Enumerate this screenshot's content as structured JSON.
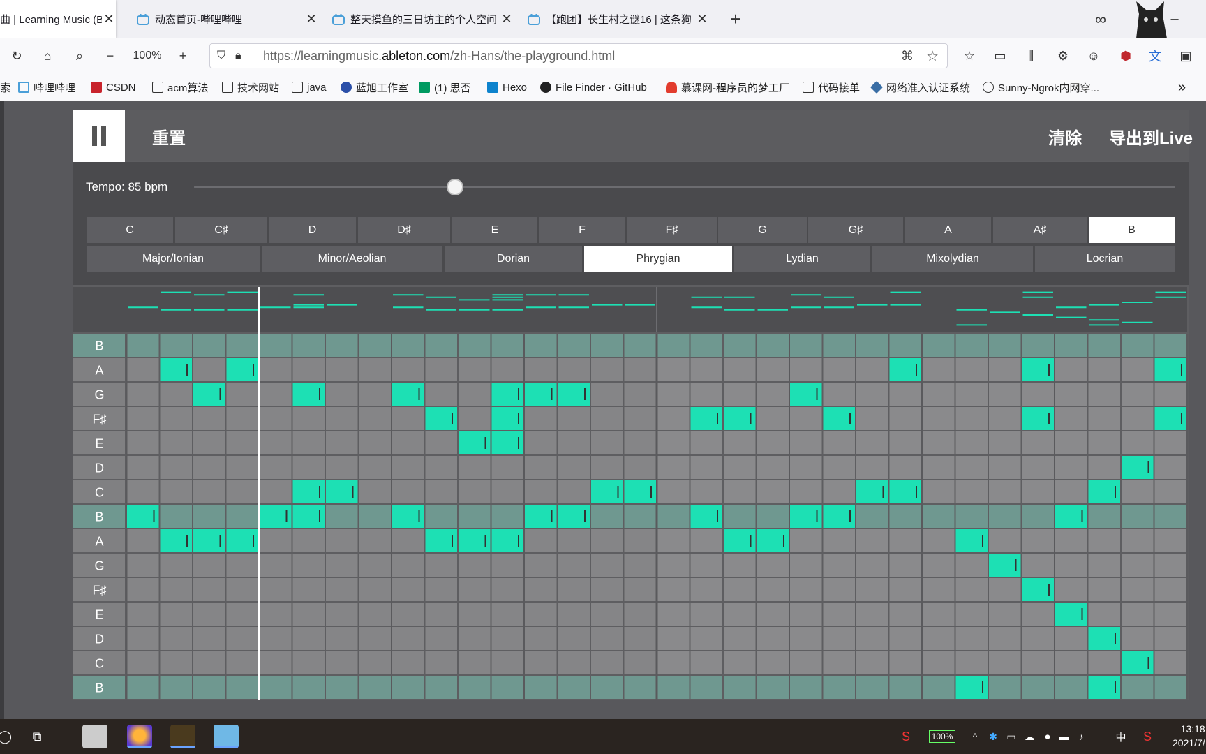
{
  "browser": {
    "tabs": [
      {
        "title": "曲 | Learning Music (Be",
        "active": true
      },
      {
        "title": "动态首页-哔哩哔哩",
        "active": false
      },
      {
        "title": "整天摸鱼的三日坊主的个人空间",
        "active": false
      },
      {
        "title": "【跑团】长生村之谜16 | 这条狗",
        "active": false
      }
    ],
    "new_tab": "+",
    "zoom": "100%",
    "url_prefix": "https://learningmusic.",
    "url_domain": "ableton.com",
    "url_path": "/zh-Hans/the-playground.html",
    "bookmarks": [
      "索",
      "哔哩哔哩",
      "CSDN",
      "acm算法",
      "技术网站",
      "java",
      "蓝旭工作室",
      "(1) 思否",
      "Hexo",
      "File Finder · GitHub",
      "慕课网-程序员的梦工厂",
      "代码接单",
      "网络准入认证系统",
      "Sunny-Ngrok内网穿..."
    ]
  },
  "app": {
    "reset_label": "重置",
    "clear_label": "清除",
    "export_label": "导出到Live",
    "tempo_label": "Tempo: 85 bpm",
    "tempo_bpm": 85,
    "keys": [
      "C",
      "C♯",
      "D",
      "D♯",
      "E",
      "F",
      "F♯",
      "G",
      "G♯",
      "A",
      "A♯",
      "B"
    ],
    "selected_key": "B",
    "modes": [
      "Major/Ionian",
      "Minor/Aeolian",
      "Dorian",
      "Phrygian",
      "Lydian",
      "Mixolydian",
      "Locrian"
    ],
    "selected_mode": "Phrygian",
    "row_labels": [
      "B",
      "A",
      "G",
      "F♯",
      "E",
      "D",
      "C",
      "B",
      "A",
      "G",
      "F♯",
      "E",
      "D",
      "C",
      "B"
    ],
    "playhead_step": 4,
    "steps": 32,
    "notes": [
      [
        0,
        7
      ],
      [
        1,
        1
      ],
      [
        1,
        8
      ],
      [
        2,
        2
      ],
      [
        2,
        8
      ],
      [
        3,
        1
      ],
      [
        3,
        8
      ],
      [
        4,
        7
      ],
      [
        5,
        2
      ],
      [
        5,
        6
      ],
      [
        5,
        7
      ],
      [
        6,
        6
      ],
      [
        8,
        2
      ],
      [
        8,
        7
      ],
      [
        9,
        3
      ],
      [
        9,
        8
      ],
      [
        10,
        4
      ],
      [
        10,
        8
      ],
      [
        11,
        2
      ],
      [
        11,
        3
      ],
      [
        11,
        4
      ],
      [
        11,
        8
      ],
      [
        12,
        2
      ],
      [
        12,
        7
      ],
      [
        13,
        2
      ],
      [
        13,
        7
      ],
      [
        14,
        6
      ],
      [
        15,
        6
      ],
      [
        17,
        3
      ],
      [
        17,
        7
      ],
      [
        18,
        3
      ],
      [
        18,
        8
      ],
      [
        19,
        8
      ],
      [
        20,
        2
      ],
      [
        20,
        7
      ],
      [
        21,
        3
      ],
      [
        21,
        7
      ],
      [
        22,
        6
      ],
      [
        23,
        1
      ],
      [
        23,
        6
      ],
      [
        25,
        8
      ],
      [
        25,
        14
      ],
      [
        26,
        9
      ],
      [
        27,
        1
      ],
      [
        27,
        3
      ],
      [
        27,
        10
      ],
      [
        28,
        7
      ],
      [
        28,
        11
      ],
      [
        29,
        6
      ],
      [
        29,
        12
      ],
      [
        29,
        14
      ],
      [
        30,
        5
      ],
      [
        30,
        13
      ],
      [
        31,
        1
      ],
      [
        31,
        3
      ]
    ]
  },
  "taskbar": {
    "battery": "100%",
    "ime": "中",
    "time": "13:18",
    "date": "2021/7/"
  }
}
